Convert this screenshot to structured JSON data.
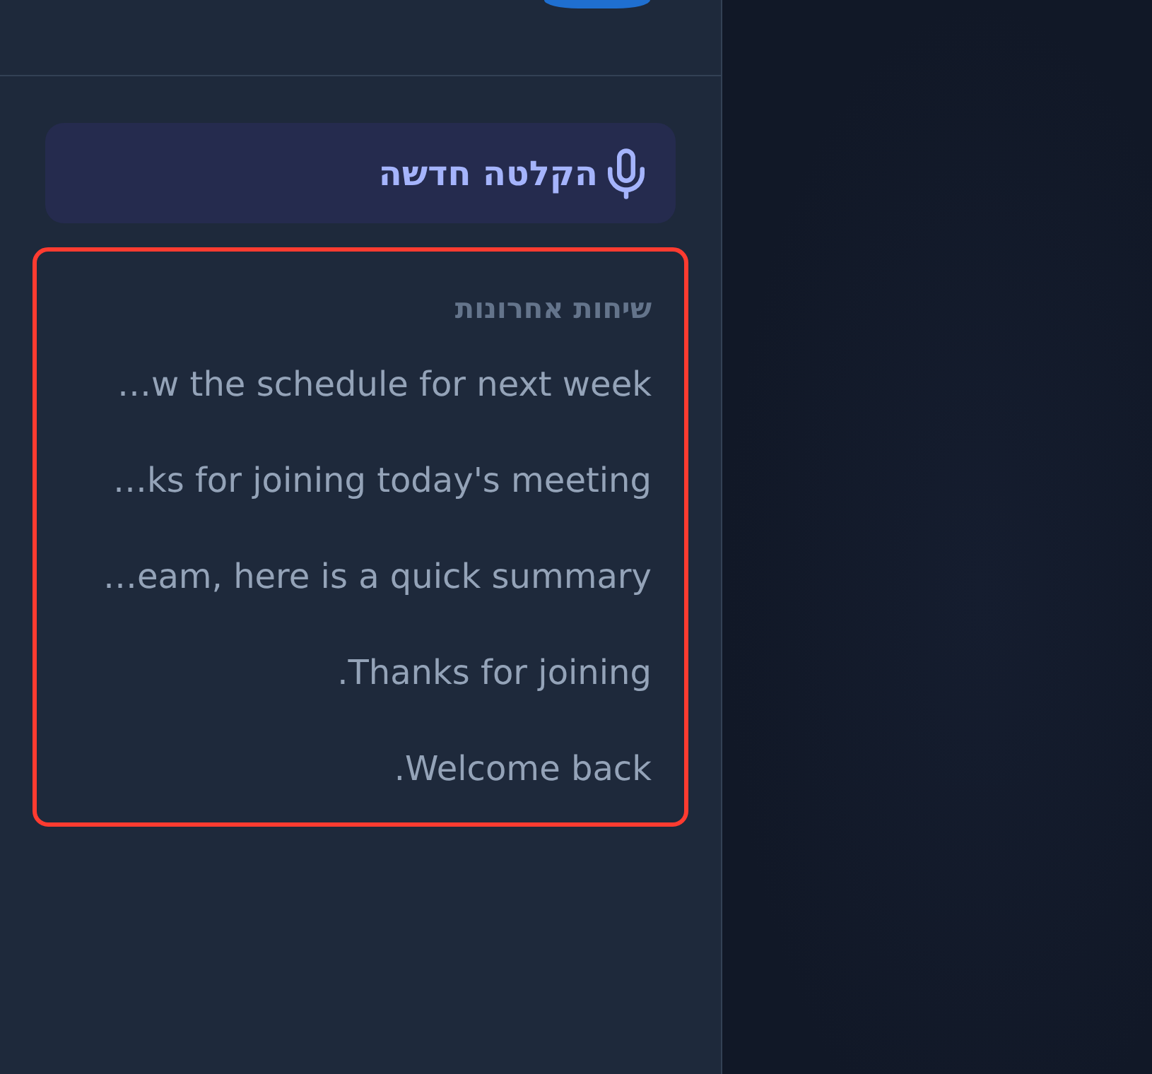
{
  "new_recording_button": {
    "label": "הקלטה חדשה"
  },
  "recent_conversations": {
    "highlighted": true,
    "heading": "שיחות אחרונות",
    "items": [
      {
        "title": "w the schedule for next week…",
        "selected": false
      },
      {
        "title": "ks for joining today's meeting…",
        "selected": false
      },
      {
        "title": "eam, here is a quick summary…",
        "selected": false
      },
      {
        "title": "Thanks for joining.",
        "selected": false
      },
      {
        "title": "Welcome back.",
        "selected": false
      }
    ]
  }
}
